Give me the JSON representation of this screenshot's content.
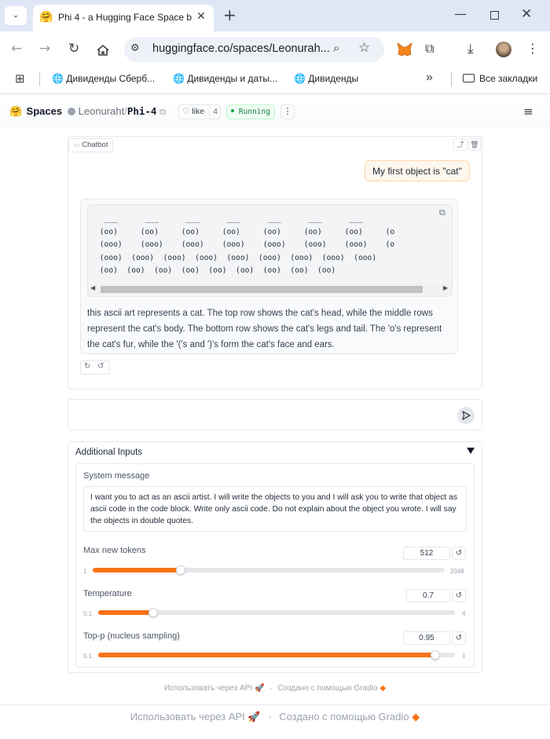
{
  "browser": {
    "tab_title": "Phi 4 - a Hugging Face Space b",
    "url": "huggingface.co/spaces/Leonurah...",
    "bookmarks": [
      "Дивиденды Сберб...",
      "Дивиденды и даты...",
      "Дивиденды"
    ],
    "all_bookmarks": "Все закладки",
    "more": "»"
  },
  "hf": {
    "spaces": "Spaces",
    "owner": "Leonuraht",
    "sep": "/",
    "repo": "Phi-4",
    "like": "like",
    "likes": "4",
    "status": "Running"
  },
  "chat": {
    "label": "Chatbot",
    "user_message": "My first object is \"cat\"",
    "code_lines": [
      "  ___      ___      ___      ___      ___      ___      ___",
      " (oo)     (oo)     (oo)     (oo)     (oo)     (oo)     (oo)     (o",
      " (ooo)    (ooo)    (ooo)    (ooo)    (ooo)    (ooo)    (ooo)    (o",
      " (ooo)  (ooo)  (ooo)  (ooo)  (ooo)  (ooo)  (ooo)  (ooo)  (ooo)",
      " (oo)  (oo)  (oo)  (oo)  (oo)  (oo)  (oo)  (oo)  (oo)"
    ],
    "reply_text": "this ascii art represents a cat. The top row shows the cat's head, while the middle rows represent the cat's body. The bottom row shows the cat's legs and tail. The 'o's represent the cat's fur, while the '('s and ')'s form the cat's face and ears.",
    "input_placeholder": ""
  },
  "additional": {
    "title": "Additional Inputs",
    "system_label": "System message",
    "system_value": "I want you to act as an ascii artist. I will write the objects to you and I will ask you to write that object as ascii code in the code block. Write only ascii code. Do not explain about the object you wrote. I will say the objects in double quotes.",
    "sliders": [
      {
        "label": "Max new tokens",
        "value": "512",
        "min": "1",
        "max": "2048",
        "fraction": 0.2495
      },
      {
        "label": "Temperature",
        "value": "0.7",
        "min": "0.1",
        "max": "4",
        "fraction": 0.154
      },
      {
        "label": "Top-p (nucleus sampling)",
        "value": "0.95",
        "min": "0.1",
        "max": "1",
        "fraction": 0.944
      }
    ]
  },
  "footer": {
    "api": "Использовать через API",
    "dot": "·",
    "built": "Создано с помощью Gradio"
  },
  "colors": {
    "accent": "#f97316",
    "user_bubble": "#fff7ed",
    "running": "#16a34a"
  }
}
